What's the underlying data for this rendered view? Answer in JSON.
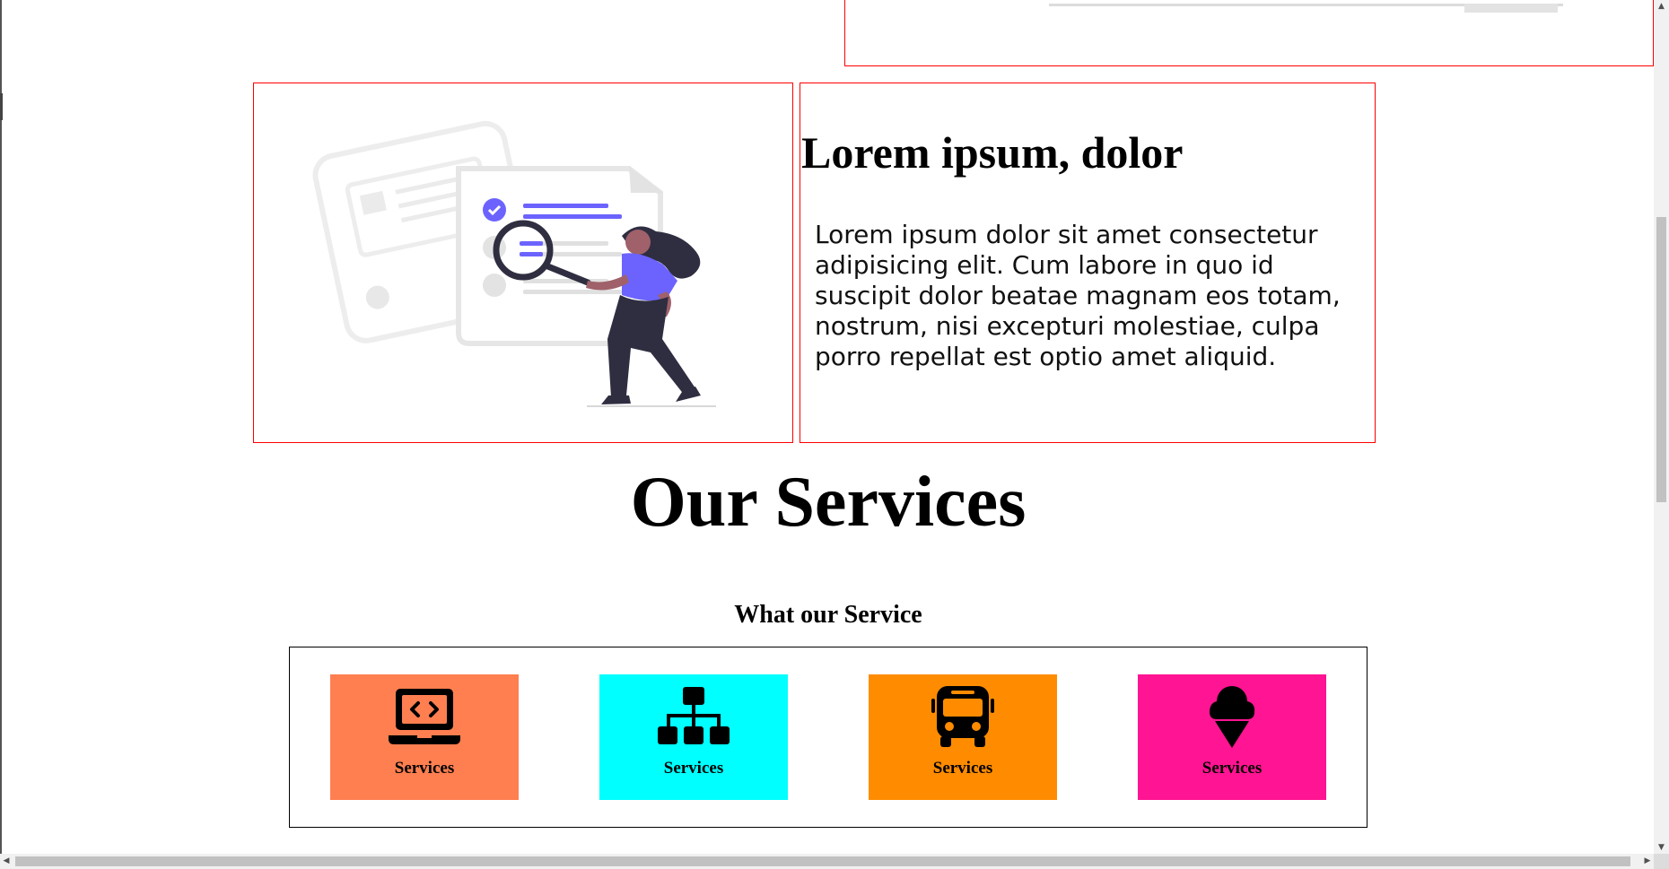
{
  "about": {
    "title": "Lorem ipsum, dolor",
    "body": "Lorem ipsum dolor sit amet consectetur adipisicing elit. Cum labore in quo id suscipit dolor beatae magnam eos totam, nostrum, nisi excepturi molestiae, culpa porro repellat est optio amet aliquid.",
    "illustration_icon": "person-with-magnifier-illustration"
  },
  "services": {
    "title": "Our Services",
    "subtitle": "What our Service",
    "cards": [
      {
        "label": "Services",
        "icon": "laptop-code-icon",
        "color": "#ff7f50"
      },
      {
        "label": "Services",
        "icon": "sitemap-icon",
        "color": "#00ffff"
      },
      {
        "label": "Services",
        "icon": "bus-icon",
        "color": "#ff8c00"
      },
      {
        "label": "Services",
        "icon": "ice-cream-icon",
        "color": "#ff1493"
      }
    ]
  },
  "colors": {
    "box_border": "#ff0000",
    "illustration_accent": "#6c63ff",
    "illustration_dark": "#2f2e41"
  }
}
